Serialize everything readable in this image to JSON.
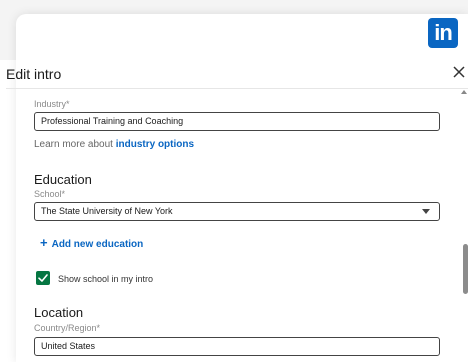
{
  "brand": {
    "logo_text": "in"
  },
  "modal": {
    "title": "Edit intro"
  },
  "industry": {
    "label": "Industry*",
    "value": "Professional Training and Coaching",
    "help_prefix": "Learn more about ",
    "help_link": "industry options"
  },
  "education": {
    "heading": "Education",
    "school_label": "School*",
    "school_value": "The State University of New York",
    "add_label": "Add new education",
    "show_school_label": "Show school in my intro",
    "show_school_checked": true
  },
  "location": {
    "heading": "Location",
    "country_label": "Country/Region*",
    "country_value": "United States"
  },
  "colors": {
    "accent": "#0a66c2",
    "check": "#057642"
  },
  "icons": [
    "linkedin-logo-icon",
    "close-icon",
    "plus-icon",
    "checkmark-icon",
    "chevron-down-icon"
  ]
}
